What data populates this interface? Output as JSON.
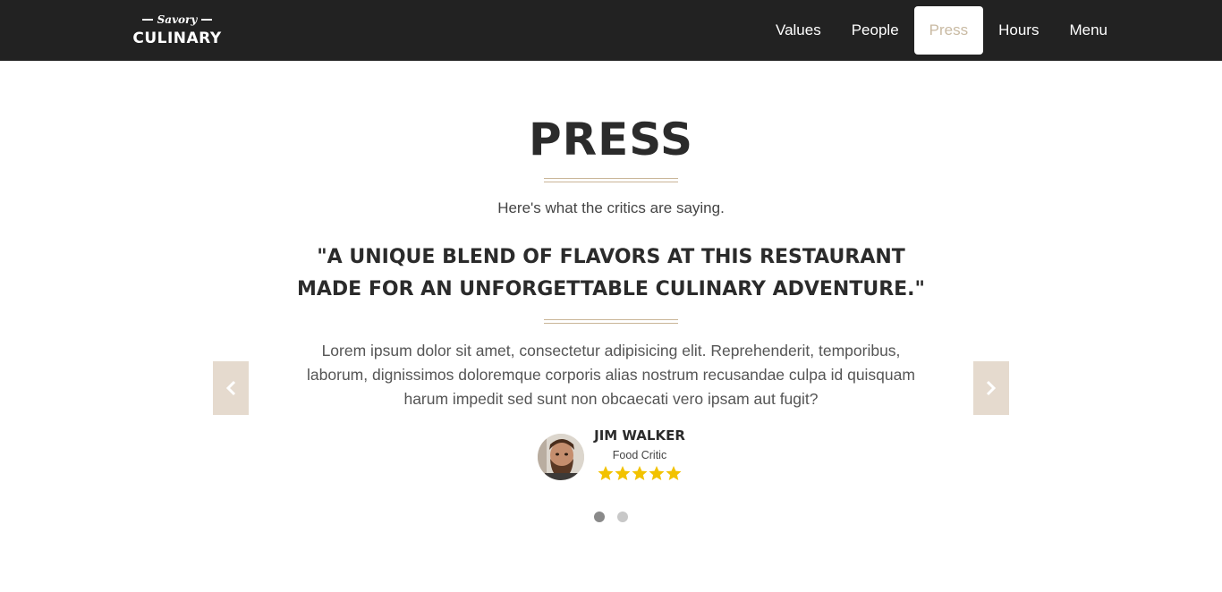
{
  "brand": {
    "script": "Savory",
    "name": "CULINARY"
  },
  "nav": {
    "items": [
      {
        "label": "Values",
        "active": false
      },
      {
        "label": "People",
        "active": false
      },
      {
        "label": "Press",
        "active": true
      },
      {
        "label": "Hours",
        "active": false
      },
      {
        "label": "Menu",
        "active": false
      }
    ]
  },
  "section": {
    "title": "PRESS",
    "subtitle": "Here's what the critics are saying."
  },
  "testimonial": {
    "quote": "\"A UNIQUE BLEND OF FLAVORS AT THIS RESTAURANT MADE FOR AN UNFORGETTABLE CULINARY ADVENTURE.\"",
    "body": "Lorem ipsum dolor sit amet, consectetur adipisicing elit. Reprehenderit, temporibus, laborum, dignissimos doloremque corporis alias nostrum recusandae culpa id quisquam harum impedit sed sunt non obcaecati vero ipsam aut fugit?",
    "author_name": "JIM WALKER",
    "author_role": "Food Critic",
    "rating": 5,
    "rating_max": 5
  },
  "carousel": {
    "slide_count": 2,
    "active_index": 0,
    "prev_icon": "chevron-left-icon",
    "next_icon": "chevron-right-icon"
  },
  "colors": {
    "navbar_bg": "#222222",
    "accent": "#c9b597",
    "active_nav_text": "#c9baa3",
    "arrow_bg": "#e5dace",
    "star": "#f2c200"
  }
}
